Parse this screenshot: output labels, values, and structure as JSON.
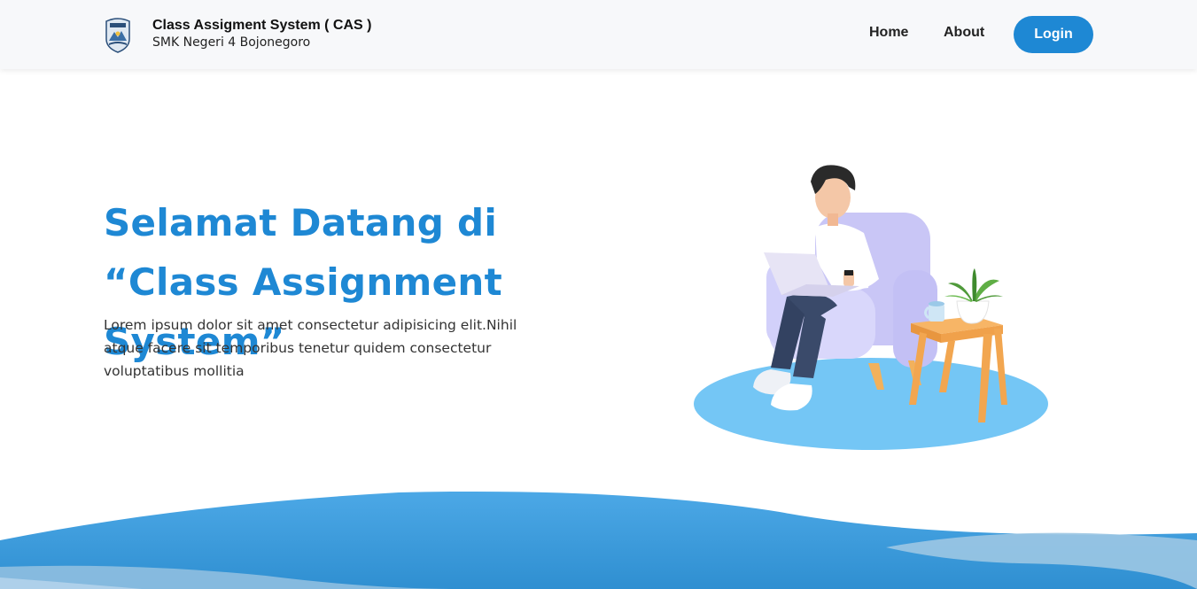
{
  "header": {
    "logo": "school-crest-logo",
    "title": "Class Assigment System ( CAS )",
    "subtitle": "SMK Negeri 4 Bojonegoro",
    "nav": {
      "home_label": "Home",
      "about_label": "About",
      "login_label": "Login"
    }
  },
  "hero": {
    "title": "Selamat Datang di “Class Assignment System”",
    "description": "Lorem ipsum dolor sit amet consectetur adipisicing elit.Nihil atque facere sit temporibus tenetur quidem consectetur voluptatibus mollitia",
    "illustration": "person-working-on-laptop-illustration"
  },
  "colors": {
    "accent": "#1e88d4",
    "navbar_bg": "#f7f8fa",
    "wave_light": "#9cc6e3",
    "wave_main": "#3a9ddf",
    "floor_disc": "#74c6f5"
  }
}
